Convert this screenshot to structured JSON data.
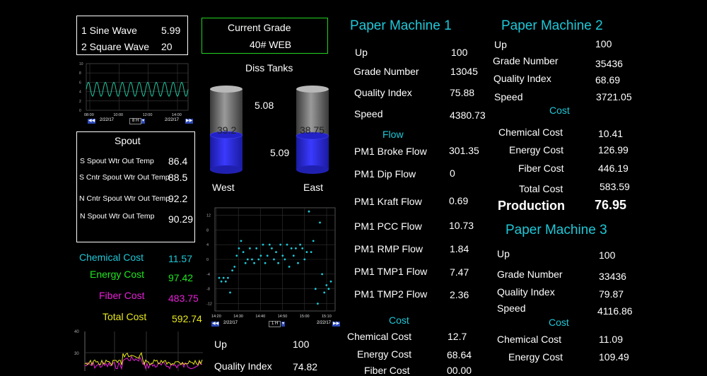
{
  "sine_box": {
    "rows": [
      {
        "label": "1 Sine Wave",
        "value": "5.99"
      },
      {
        "label": "2 Square Wave",
        "value": "20"
      }
    ]
  },
  "wave_trend": {
    "y_ticks": [
      "10",
      "8",
      "6",
      "4",
      "2",
      "0"
    ],
    "x_ticks": [
      "08:00",
      "10:00",
      "12:00",
      "14:00"
    ],
    "date_left": "2/22/17",
    "date_right": "2/22/17",
    "span": "8 H",
    "colors": {
      "sine": "#1ec8a0",
      "grid": "#3a3a3a"
    },
    "chart_data": {
      "type": "line",
      "series": [
        {
          "function": "sine",
          "mean": 4.5,
          "amplitude": 1.5,
          "cycles": 12
        }
      ],
      "ylim": [
        0,
        10
      ]
    }
  },
  "grade": {
    "title": "Current Grade",
    "value": "40# WEB"
  },
  "diss_tanks": {
    "title": "Diss Tanks",
    "west": {
      "label": "West",
      "level_value": "39.2",
      "reading": "5.08",
      "fill_percent": 43
    },
    "east": {
      "label": "East",
      "level_value": "38.75",
      "reading": "5.09",
      "fill_percent": 42
    }
  },
  "spout": {
    "title": "Spout",
    "rows": [
      {
        "label": "S Spout Wtr Out Temp",
        "value": "86.4"
      },
      {
        "label": "S Cntr Spout Wtr Out Temp",
        "value": "88.5"
      },
      {
        "label": "N Cntr Spout Wtr Out Temp",
        "value": "92.2"
      },
      {
        "label": "N Spout Wtr Out Temp",
        "value": "90.29"
      }
    ]
  },
  "costs_left": [
    {
      "label": "Chemical Cost",
      "value": "11.57",
      "color": "#1ec8d8"
    },
    {
      "label": "Energy Cost",
      "value": "97.42",
      "color": "#1ee81e"
    },
    {
      "label": "Fiber Cost",
      "value": "483.75",
      "color": "#e81ed8"
    },
    {
      "label": "Total Cost",
      "value": "592.74",
      "color": "#e8e81e"
    }
  ],
  "scatter_trend": {
    "y_ticks": [
      "12",
      "8",
      "4",
      "0",
      "-4",
      "-8",
      "-12"
    ],
    "x_ticks": [
      "14:20",
      "14:30",
      "14:40",
      "14:50",
      "15:00",
      "15:10"
    ],
    "date_left": "2/22/17",
    "date_right": "2/22/17",
    "span": "1 H",
    "color": "#1ec8d8",
    "chart_data": {
      "type": "scatter",
      "ylim": [
        -14,
        14
      ],
      "x": [
        0,
        1,
        2,
        3,
        4,
        5,
        6,
        7,
        8,
        9,
        10,
        11,
        12,
        13,
        14,
        15,
        16,
        17,
        18,
        19,
        20,
        21,
        22,
        23,
        24,
        25,
        26,
        27,
        28,
        29,
        30,
        31,
        32,
        33,
        34,
        35,
        36,
        37,
        38,
        39,
        40,
        41,
        42,
        43,
        44,
        45,
        46,
        47,
        48,
        49,
        50,
        51
      ],
      "y": [
        -5,
        -6,
        -5,
        -6,
        -5,
        -9,
        -3,
        -2,
        1,
        3,
        5,
        2,
        -1,
        0,
        3,
        0,
        -1,
        3,
        0,
        1,
        4,
        -1,
        1,
        4,
        3,
        0,
        2,
        -1,
        4,
        1,
        0,
        4,
        -2,
        3,
        1,
        3,
        -1,
        4,
        3,
        0,
        2,
        13,
        2,
        5,
        -8,
        -12,
        10,
        -4,
        -9,
        -7,
        -8,
        -6
      ]
    }
  },
  "bottom_mid": {
    "rows": [
      {
        "label": "Up",
        "value": "100"
      },
      {
        "label": "Quality Index",
        "value": "74.82"
      }
    ]
  },
  "bottom_trend": {
    "y_ticks": [
      "40",
      "30"
    ],
    "colors": {
      "a": "#e81ed8",
      "b": "#e8e81e"
    }
  },
  "pm1": {
    "title": "Paper Machine 1",
    "rows": [
      {
        "label": "Up",
        "value": "100"
      },
      {
        "label": "Grade Number",
        "value": "13045"
      },
      {
        "label": "Quality Index",
        "value": "75.88"
      },
      {
        "label": "Speed",
        "value": "4380.73"
      }
    ],
    "flow_title": "Flow",
    "flows": [
      {
        "label": "PM1 Broke Flow",
        "value": "301.35"
      },
      {
        "label": "PM1 Dip Flow",
        "value": "0"
      },
      {
        "label": "PM1 Kraft Flow",
        "value": "0.69"
      },
      {
        "label": "PM1 PCC Flow",
        "value": "10.73"
      },
      {
        "label": "PM1 RMP Flow",
        "value": "1.84"
      },
      {
        "label": "PM1 TMP1 Flow",
        "value": "7.47"
      },
      {
        "label": "PM1 TMP2 Flow",
        "value": "2.36"
      }
    ],
    "cost_title": "Cost",
    "costs": [
      {
        "label": "Chemical Cost",
        "value": "12.7"
      },
      {
        "label": "Energy Cost",
        "value": "68.64"
      },
      {
        "label": "Fiber Cost",
        "value": "00.00"
      }
    ]
  },
  "pm2": {
    "title": "Paper Machine 2",
    "rows": [
      {
        "label": "Up",
        "value": "100"
      },
      {
        "label": "Grade Number",
        "value": "35436"
      },
      {
        "label": "Quality Index",
        "value": "68.69"
      },
      {
        "label": "Speed",
        "value": "3721.05"
      }
    ],
    "cost_title": "Cost",
    "costs": [
      {
        "label": "Chemical Cost",
        "value": "10.41"
      },
      {
        "label": "Energy Cost",
        "value": "126.99"
      },
      {
        "label": "Fiber Cost",
        "value": "446.19"
      },
      {
        "label": "Total Cost",
        "value": "583.59"
      }
    ],
    "production": {
      "label": "Production",
      "value": "76.95"
    }
  },
  "pm3": {
    "title": "Paper Machine 3",
    "rows": [
      {
        "label": "Up",
        "value": "100"
      },
      {
        "label": "Grade Number",
        "value": "33436"
      },
      {
        "label": "Quality Index",
        "value": "79.87"
      },
      {
        "label": "Speed",
        "value": "4116.86"
      }
    ],
    "cost_title": "Cost",
    "costs": [
      {
        "label": "Chemical Cost",
        "value": "11.09"
      },
      {
        "label": "Energy Cost",
        "value": "109.49"
      }
    ]
  }
}
